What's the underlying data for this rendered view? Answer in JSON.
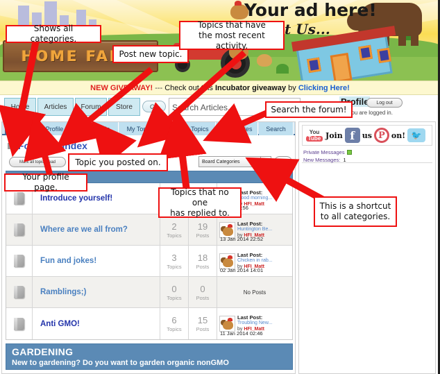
{
  "banner": {
    "site_name": "HOME FARM",
    "ad_text": "Your ad here!",
    "ad_text2": "t Us..."
  },
  "giveaway": {
    "headline": "NEW GIVEAWAY!",
    "dash": "---",
    "pre": "Check out this",
    "bold": "Incubator giveaway",
    "mid": "by",
    "link": "Clicking Here!"
  },
  "mainnav": {
    "items": [
      {
        "label": "Home"
      },
      {
        "label": "Articles"
      },
      {
        "label": "Forum"
      },
      {
        "label": "Store"
      }
    ],
    "go_label": "Go",
    "search_placeholder": "Search Articles...",
    "profile_label": "Profile",
    "logout_label": "Log out",
    "logged_in_text": "att, you are logged in."
  },
  "forum": {
    "tabs": [
      {
        "label": "Index",
        "active": true
      },
      {
        "label": "Profile",
        "active": false
      },
      {
        "label": "New Topic",
        "active": false
      },
      {
        "label": "My Topics",
        "active": false
      },
      {
        "label": "Recent Topics",
        "active": false
      },
      {
        "label": "No Replies",
        "active": false
      },
      {
        "label": "Search",
        "active": false
      }
    ],
    "breadcrumb": {
      "root": "Forum",
      "sep": "»",
      "current": "Index"
    },
    "mark_all_read": "Mark all topics read",
    "category_select": {
      "value": "Board Categories",
      "arrow": "▼"
    },
    "category_go": "Go",
    "rows": [
      {
        "name": "Introduce yourself!",
        "name_color": "#2233aa",
        "topics": "",
        "topics_label": "",
        "posts": "",
        "posts_label": "",
        "last_post_label": "Last Post:",
        "last_post_title": "Good morning...",
        "by_label": "by",
        "user": "HFI_Matt",
        "date": "Today 13:56",
        "has_posts": true
      },
      {
        "name": "Where are we all from?",
        "name_color": "#4a80c0",
        "topics": "2",
        "topics_label": "Topics",
        "posts": "19",
        "posts_label": "Posts",
        "last_post_label": "Last Post:",
        "last_post_title": "Huntington Be...",
        "by_label": "by",
        "user": "HFI_Matt",
        "date": "13 Jan 2014 22:52",
        "has_posts": true
      },
      {
        "name": "Fun and jokes!",
        "name_color": "#4a80c0",
        "topics": "3",
        "topics_label": "Topics",
        "posts": "18",
        "posts_label": "Posts",
        "last_post_label": "Last Post:",
        "last_post_title": "Chicken in rab...",
        "by_label": "by",
        "user": "HFI_Matt",
        "date": "02 Jan 2014 14:01",
        "has_posts": true
      },
      {
        "name": "Ramblings;)",
        "name_color": "#4a80c0",
        "topics": "0",
        "topics_label": "Topics",
        "posts": "0",
        "posts_label": "Posts",
        "no_posts_label": "No Posts",
        "has_posts": false
      },
      {
        "name": "Anti GMO!",
        "name_color": "#2233aa",
        "topics": "6",
        "topics_label": "Topics",
        "posts": "15",
        "posts_label": "Posts",
        "last_post_label": "Last Post:",
        "last_post_title": "Troubling New...",
        "by_label": "by",
        "user": "HFI_Matt",
        "date": "11 Jan 2014 02:46",
        "has_posts": true
      }
    ],
    "gardening_category": {
      "title": "GARDENING",
      "description": "New to gardening? Do you want to garden organic nonGMO"
    }
  },
  "sidebar": {
    "social": {
      "youtube_line1": "You",
      "youtube_line2": "Tube",
      "join": "Join",
      "facebook": "f",
      "us": "us",
      "pinterest": "P",
      "on": "on!",
      "twitter": "🐦"
    },
    "private_messages_label": "Private Messages",
    "new_messages_label": "New Messages:",
    "new_messages_count": "1"
  },
  "annotations": [
    {
      "id": "ann-categories",
      "text": "Shows all categories."
    },
    {
      "id": "ann-newtopic",
      "text": "Post new topic."
    },
    {
      "id": "ann-recent",
      "text": "Topics that have\nthe most recent activity."
    },
    {
      "id": "ann-searchforum",
      "text": "Search the forum!"
    },
    {
      "id": "ann-mytopics",
      "text": "Topic you posted on."
    },
    {
      "id": "ann-profile",
      "text": "Your profile page."
    },
    {
      "id": "ann-noreplies",
      "text": "Topics that no one\nhas replied to."
    },
    {
      "id": "ann-shortcut",
      "text": "This is a shortcut\nto all categories."
    }
  ],
  "colors": {
    "annotation_border": "#ee1111",
    "arrow": "#ee1111",
    "category_bar": "#5b8ab5",
    "active_tab": "#3f6e9e"
  }
}
